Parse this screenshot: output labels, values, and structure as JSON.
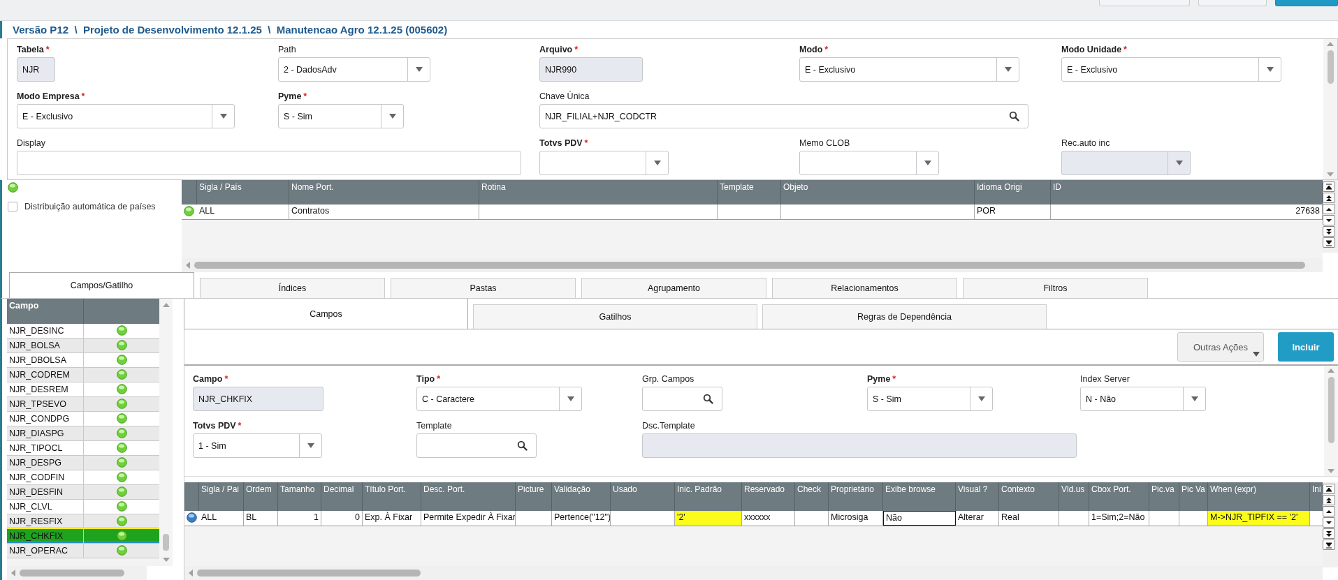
{
  "title": "Versão P12  \\  Projeto de Desenvolvimento 12.1.25  \\  Manutencao Agro 12.1.25 (005602)",
  "table_form": [
    [
      {
        "label": "Tabela",
        "mark": "*",
        "kind": "readonly",
        "value": "NJR"
      },
      {
        "label": "Path",
        "kind": "select",
        "value": "2 - DadosAdv"
      },
      {
        "label": "Arquivo",
        "mark": "*",
        "kind": "readonly",
        "value": "NJR990"
      },
      {
        "label": "Modo",
        "mark": "*",
        "kind": "select",
        "value": "E - Exclusivo"
      },
      {
        "label": "Modo Unidade",
        "mark": "*",
        "kind": "select",
        "value": "E - Exclusivo"
      }
    ],
    [
      {
        "label": "Modo Empresa",
        "mark": "*",
        "kind": "select",
        "value": "E - Exclusivo"
      },
      {
        "label": "Pyme",
        "mark": "*",
        "kind": "select",
        "value": "S - Sim"
      },
      {
        "label": "Chave Única",
        "kind": "lookup",
        "value": "NJR_FILIAL+NJR_CODCTR"
      }
    ],
    [
      {
        "label": "Display",
        "kind": "text"
      },
      {
        "label": "Totvs PDV",
        "mark": "*",
        "kind": "select"
      },
      {
        "label": "Memo CLOB",
        "kind": "select"
      },
      {
        "label": "Rec.auto inc",
        "kind": "readonly-select"
      }
    ]
  ],
  "auto_distribution": {
    "label": "Distribuição automática de países",
    "checked": false
  },
  "countries_table": {
    "columns": [
      "Sigla / País",
      "Nome Port.",
      "Rotina",
      "Template",
      "Objeto",
      "Idioma Origi",
      "ID"
    ],
    "rows": [
      [
        "ALL",
        "Contratos",
        "",
        "",
        "",
        "POR",
        "27638"
      ]
    ]
  },
  "tabs": [
    {
      "label": "Campos/Gatilho",
      "selected": true
    },
    {
      "label": "Índices",
      "selected": false
    },
    {
      "label": "Pastas",
      "selected": false
    },
    {
      "label": "Agrupamento",
      "selected": false
    },
    {
      "label": "Relacionamentos",
      "selected": false
    },
    {
      "label": "Filtros",
      "selected": false
    }
  ],
  "field_list": {
    "header": "Campo",
    "items": [
      {
        "name": "NJR_DESINC",
        "selected": false
      },
      {
        "name": "NJR_BOLSA",
        "selected": false
      },
      {
        "name": "NJR_DBOLSA",
        "selected": false
      },
      {
        "name": "NJR_CODREM",
        "selected": false
      },
      {
        "name": "NJR_DESREM",
        "selected": false
      },
      {
        "name": "NJR_TPSEVO",
        "selected": false
      },
      {
        "name": "NJR_CONDPG",
        "selected": false
      },
      {
        "name": "NJR_DIASPG",
        "selected": false
      },
      {
        "name": "NJR_TIPOCL",
        "selected": false
      },
      {
        "name": "NJR_DESPG",
        "selected": false
      },
      {
        "name": "NJR_CODFIN",
        "selected": false
      },
      {
        "name": "NJR_DESFIN",
        "selected": false
      },
      {
        "name": "NJR_CLVL",
        "selected": false
      },
      {
        "name": "NJR_RESFIX",
        "selected": false
      },
      {
        "name": "NJR_CHKFIX",
        "selected": true
      },
      {
        "name": "NJR_OPERAC",
        "selected": false
      }
    ]
  },
  "sub_tabs": [
    {
      "label": "Campos",
      "selected": true
    },
    {
      "label": "Gatilhos",
      "selected": false
    },
    {
      "label": "Regras de Dependência",
      "selected": false
    }
  ],
  "actions": {
    "more": "Outras Ações",
    "primary": "Incluir"
  },
  "field_form": [
    [
      {
        "label": "Campo",
        "mark": "*",
        "kind": "readonly",
        "value": "NJR_CHKFIX"
      },
      {
        "label": "Tipo",
        "mark": "*",
        "kind": "select",
        "value": "C - Caractere"
      },
      {
        "label": "Grp. Campos",
        "kind": "lookup"
      },
      {
        "label": "Pyme",
        "mark": "*",
        "kind": "select",
        "value": "S - Sim"
      },
      {
        "label": "Index Server",
        "kind": "select",
        "value": "N - Não"
      }
    ],
    [
      {
        "label": "Totvs PDV",
        "mark": "*",
        "kind": "select",
        "value": "1 - Sim"
      },
      {
        "label": "Template",
        "kind": "lookup"
      },
      {
        "label": "Dsc.Template",
        "kind": "readonly"
      }
    ]
  ],
  "fields_table": {
    "columns": [
      "Sigla / Pai",
      "Ordem",
      "Tamanho",
      "Decimal",
      "Título Port.",
      "Desc. Port.",
      "Picture",
      "Validação",
      "Usado",
      "Inic. Padrão",
      "Reservado",
      "Check",
      "Proprietário",
      "Exibe browse",
      "Visual ?",
      "Contexto",
      "Vld.us",
      "Cbox Port.",
      "Pic.va",
      "Pic Va",
      "When (expr)",
      "Ini"
    ],
    "rows": [
      [
        {
          "text": "ALL",
          "highlighted": false,
          "focused": false
        },
        {
          "text": "BL",
          "highlighted": false,
          "focused": false
        },
        {
          "text": "1",
          "highlighted": false,
          "focused": false
        },
        {
          "text": "0",
          "highlighted": false,
          "focused": false
        },
        {
          "text": "Exp. À Fixar",
          "highlighted": false,
          "focused": false
        },
        {
          "text": "Permite Expedir À Fixar",
          "highlighted": false,
          "focused": false
        },
        {
          "text": "",
          "highlighted": false,
          "focused": false
        },
        {
          "text": "Pertence(\"12\")",
          "highlighted": false,
          "focused": false
        },
        {
          "text": "",
          "highlighted": false,
          "focused": false
        },
        {
          "text": "'2'",
          "highlighted": true,
          "focused": false
        },
        {
          "text": "xxxxxx",
          "highlighted": false,
          "focused": false
        },
        {
          "text": "",
          "highlighted": false,
          "focused": false
        },
        {
          "text": "Microsiga",
          "highlighted": false,
          "focused": false
        },
        {
          "text": "Não",
          "highlighted": false,
          "focused": true
        },
        {
          "text": "Alterar",
          "highlighted": false,
          "focused": false
        },
        {
          "text": "Real",
          "highlighted": false,
          "focused": false
        },
        {
          "text": "",
          "highlighted": false,
          "focused": false
        },
        {
          "text": "1=Sim;2=Não",
          "highlighted": false,
          "focused": false
        },
        {
          "text": "",
          "highlighted": false,
          "focused": false
        },
        {
          "text": "",
          "highlighted": false,
          "focused": false
        },
        {
          "text": "M->NJR_TIPFIX == '2'",
          "highlighted": true,
          "focused": false
        }
      ]
    ]
  }
}
